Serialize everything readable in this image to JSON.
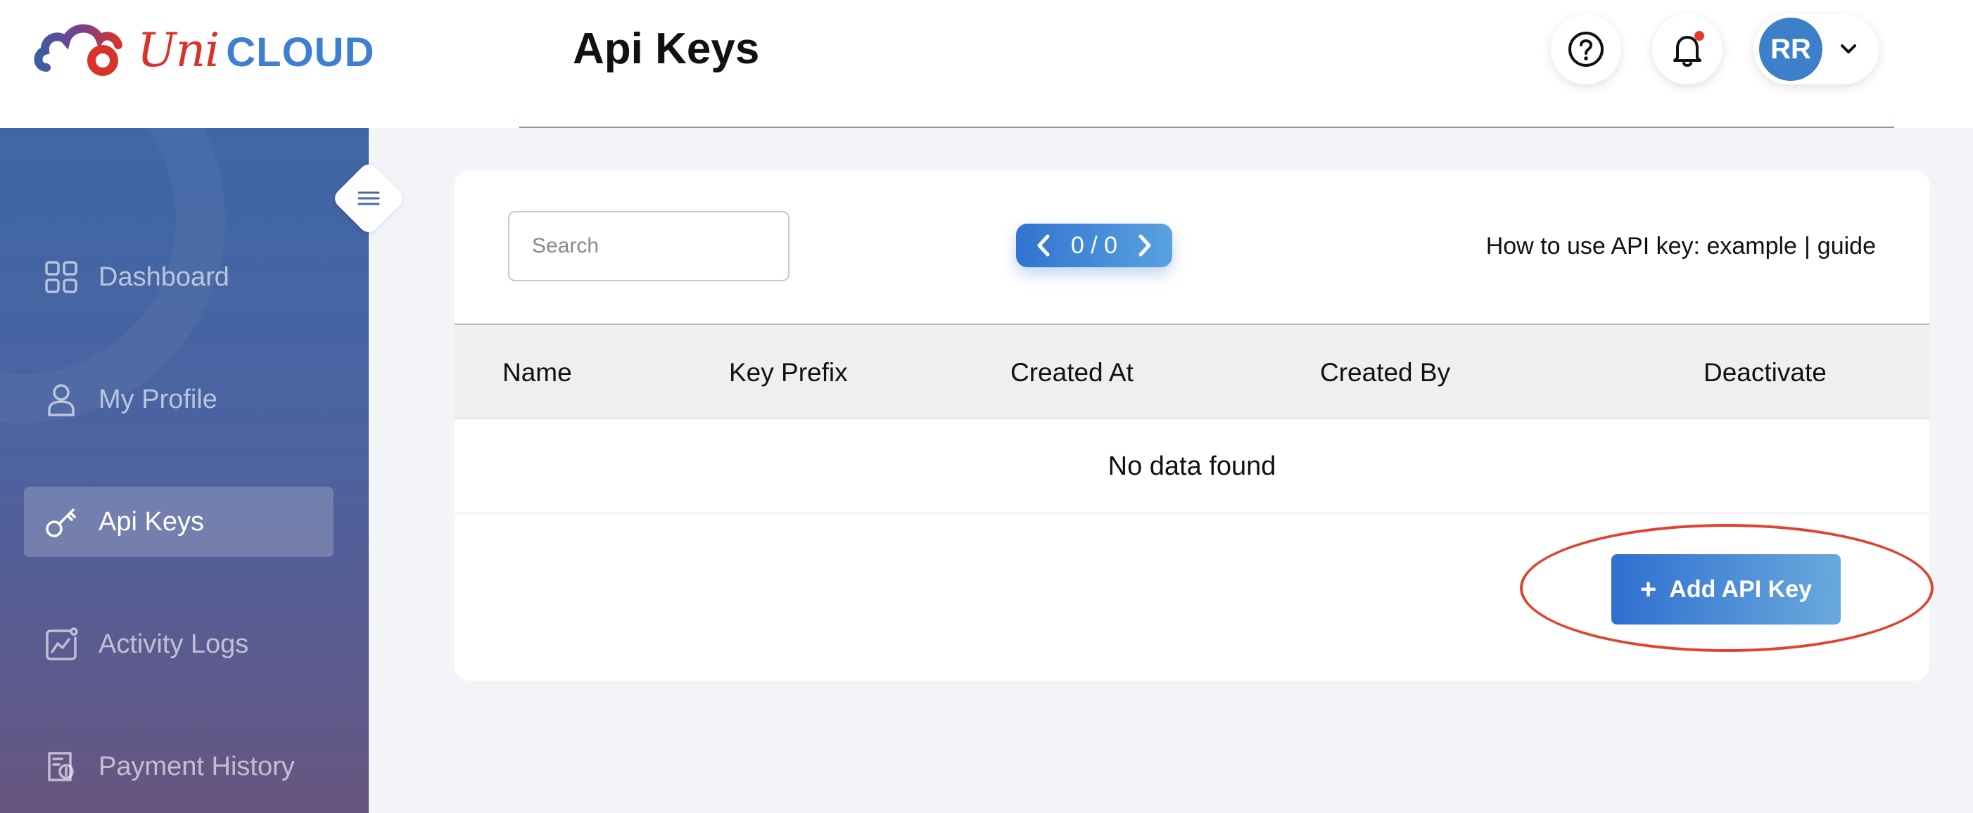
{
  "app": {
    "logo_uni": "Uni",
    "logo_cloud": "CLOUD",
    "brand_colors": {
      "red": "#d7332a",
      "blue": "#3d7fd1"
    }
  },
  "header": {
    "title": "Api Keys",
    "help_icon": "question-circle-icon",
    "bell_icon": "bell-icon",
    "user_initials": "RR",
    "user_menu_icon": "chevron-down-icon"
  },
  "sidebar": {
    "collapse_icon": "hamburger-menu-icon",
    "items": [
      {
        "label": "Dashboard",
        "icon": "grid-icon",
        "active": false
      },
      {
        "label": "My Profile",
        "icon": "user-icon",
        "active": false
      },
      {
        "label": "Api Keys",
        "icon": "key-icon",
        "active": true
      },
      {
        "label": "Activity Logs",
        "icon": "activity-chart-icon",
        "active": false
      },
      {
        "label": "Payment History",
        "icon": "payment-receipt-icon",
        "active": false
      }
    ]
  },
  "main": {
    "search": {
      "placeholder": "Search",
      "value": ""
    },
    "pager": {
      "text": "0 / 0"
    },
    "help_text": {
      "prefix": "How to use API key:",
      "example_link": "example",
      "separator": "|",
      "guide_link": "guide"
    },
    "table": {
      "columns": [
        "Name",
        "Key Prefix",
        "Created At",
        "Created By",
        "Deactivate"
      ],
      "rows": [],
      "empty_message": "No data found"
    },
    "add_button": {
      "icon": "plus-icon",
      "label": "Add API Key"
    },
    "accent_colors": {
      "primary": "#2f6fcf",
      "highlight": "#e2412c"
    }
  }
}
